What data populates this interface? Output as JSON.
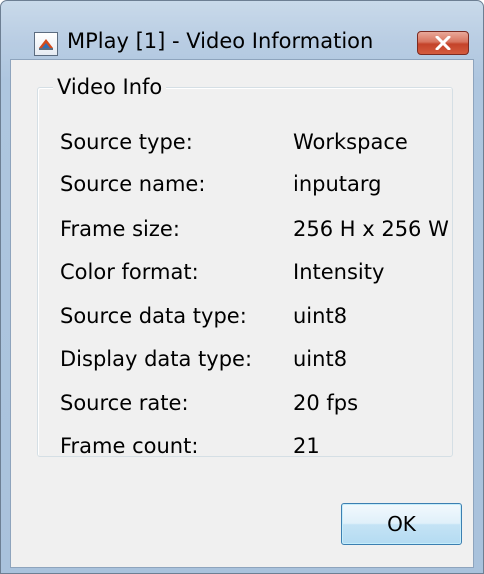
{
  "window": {
    "title": "MPlay [1] - Video Information",
    "icon": "mplay-app-icon",
    "close_icon": "close-x-icon"
  },
  "group": {
    "title": "Video Info"
  },
  "rows": [
    {
      "label": "Source type:",
      "value": "Workspace"
    },
    {
      "label": "Source name:",
      "value": "inputarg"
    },
    {
      "label": "Frame size:",
      "value": "256 H x 256 W"
    },
    {
      "label": "Color format:",
      "value": "Intensity"
    },
    {
      "label": "Source data type:",
      "value": "uint8"
    },
    {
      "label": "Display data type:",
      "value": "uint8"
    },
    {
      "label": "Source rate:",
      "value": "20 fps"
    },
    {
      "label": "Frame count:",
      "value": "21"
    }
  ],
  "buttons": {
    "ok_label": "OK"
  },
  "colors": {
    "titlebar": "#b9cde3",
    "close_button": "#c4432a",
    "ok_button": "#c4e3f5"
  }
}
